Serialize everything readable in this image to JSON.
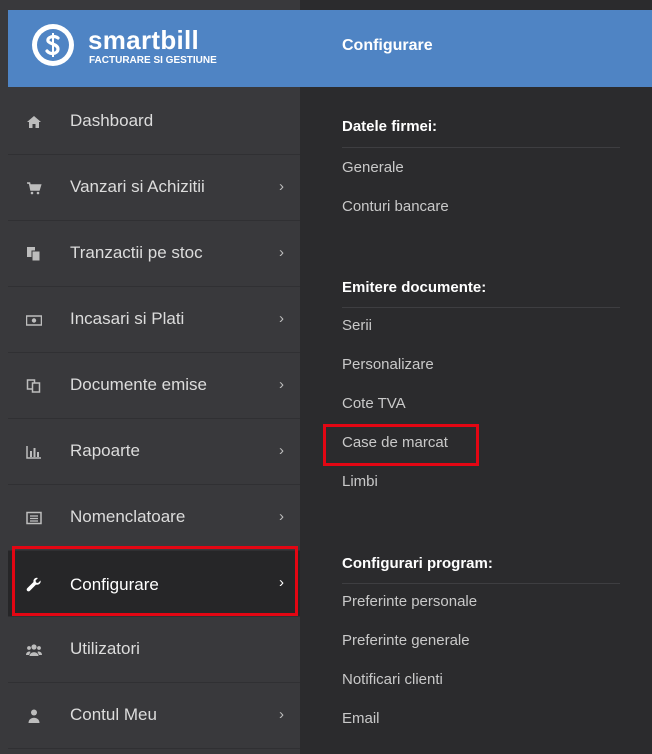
{
  "brand": {
    "name": "smartbill",
    "tagline": "FACTURARE SI GESTIUNE",
    "colors": {
      "header_blue": "#4f84c4",
      "highlight_red": "#e30613"
    }
  },
  "sidebar": {
    "items": [
      {
        "label": "Dashboard",
        "icon": "home-icon",
        "has_chevron": false
      },
      {
        "label": "Vanzari si Achizitii",
        "icon": "cart-icon",
        "has_chevron": true
      },
      {
        "label": "Tranzactii pe stoc",
        "icon": "copy-icon",
        "has_chevron": true
      },
      {
        "label": "Incasari si Plati",
        "icon": "money-icon",
        "has_chevron": true
      },
      {
        "label": "Documente emise",
        "icon": "documents-icon",
        "has_chevron": true
      },
      {
        "label": "Rapoarte",
        "icon": "bar-chart-icon",
        "has_chevron": true
      },
      {
        "label": "Nomenclatoare",
        "icon": "list-icon",
        "has_chevron": true
      },
      {
        "label": "Configurare",
        "icon": "wrench-icon",
        "has_chevron": true,
        "active": true
      },
      {
        "label": "Utilizatori",
        "icon": "users-icon",
        "has_chevron": false
      },
      {
        "label": "Contul Meu",
        "icon": "user-icon",
        "has_chevron": true
      }
    ],
    "chevron": "›"
  },
  "panel": {
    "title": "Configurare",
    "sections": [
      {
        "title": "Datele firmei:",
        "links": [
          "Generale",
          "Conturi bancare"
        ]
      },
      {
        "title": "Emitere documente:",
        "links": [
          "Serii",
          "Personalizare",
          "Cote TVA",
          "Case de marcat",
          "Limbi"
        ]
      },
      {
        "title": "Configurari program:",
        "links": [
          "Preferinte personale",
          "Preferinte generale",
          "Notificari clienti",
          "Email"
        ]
      }
    ]
  }
}
